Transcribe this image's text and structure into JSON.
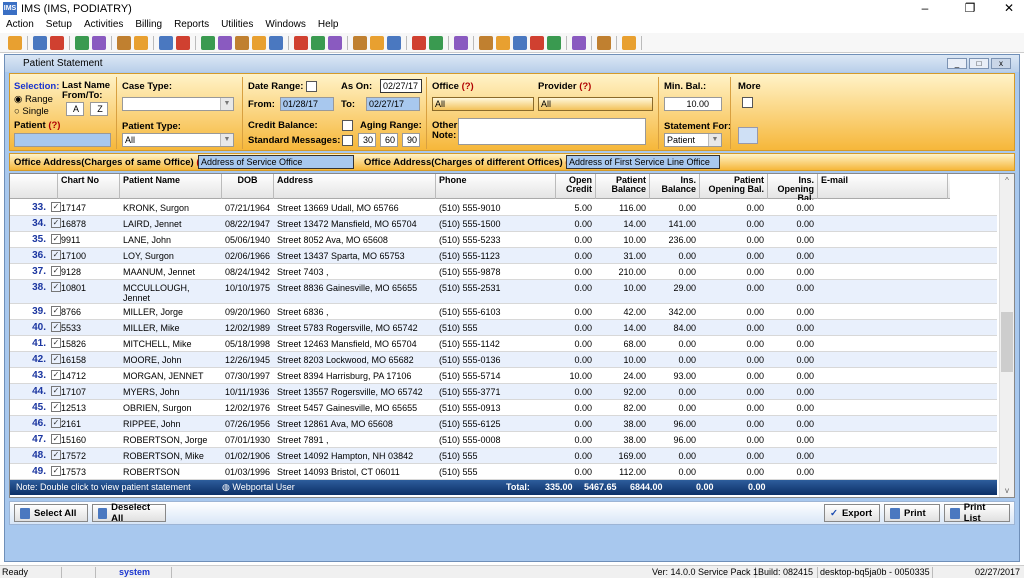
{
  "app": {
    "title": "IMS (IMS, PODIATRY)"
  },
  "menu": [
    "Action",
    "Setup",
    "Activities",
    "Billing",
    "Reports",
    "Utilities",
    "Windows",
    "Help"
  ],
  "window": {
    "title": "Patient Statement"
  },
  "filter": {
    "selection_label": "Selection:",
    "range_label": "Range",
    "single_label": "Single",
    "range_selected": true,
    "last_name_label": "Last Name From/To:",
    "from_letter": "A",
    "to_letter": "Z",
    "patient_label": "Patient",
    "help": "(?)",
    "patient_value": "",
    "case_type_label": "Case Type:",
    "case_type_value": "",
    "patient_type_label": "Patient Type:",
    "patient_type_value": "All",
    "date_range_label": "Date Range:",
    "as_on_label": "As On:",
    "as_on_value": "02/27/17",
    "from_label": "From:",
    "from_value": "01/28/17",
    "to_label": "To:",
    "to_value": "02/27/17",
    "credit_balance_label": "Credit Balance:",
    "standard_messages_label": "Standard Messages:",
    "aging_range_label": "Aging Range:",
    "aging": [
      "30",
      "60",
      "90"
    ],
    "office_label": "Office",
    "office_value": "All",
    "provider_label": "Provider",
    "provider_value": "All",
    "other_note_label": "Other Note:",
    "other_note_value": "",
    "min_bal_label": "Min. Bal.:",
    "min_bal_value": "10.00",
    "statement_for_label": "Statement For:",
    "statement_for_value": "Patient",
    "more_label": "More"
  },
  "address": {
    "same_label": "Office Address(Charges of same Office)",
    "same_value": "Address of Service Office",
    "diff_label": "Office Address(Charges of different Offices)",
    "diff_value": "Address of First Service Line Office"
  },
  "grid": {
    "headers": [
      "Chart No",
      "Patient Name",
      "DOB",
      "Address",
      "Phone",
      "Open Credit",
      "Patient Balance",
      "Ins. Balance",
      "Patient Opening Bal.",
      "Ins. Opening Bal.",
      "E-mail"
    ],
    "rows": [
      [
        "33.",
        "17147",
        "KRONK, Surgon",
        "07/21/1964",
        "Street 13669 Udall, MO 65766",
        "(510) 555-9010",
        "5.00",
        "116.00",
        "0.00",
        "0.00",
        "0.00"
      ],
      [
        "34.",
        "16878",
        "LAIRD, Jennet",
        "08/22/1947",
        "Street 13472 Mansfield, MO 65704",
        "(510) 555-1500",
        "0.00",
        "14.00",
        "141.00",
        "0.00",
        "0.00"
      ],
      [
        "35.",
        "9911",
        "LANE, John",
        "05/06/1940",
        "Street 8052 Ava, MO 65608",
        "(510) 555-5233",
        "0.00",
        "10.00",
        "236.00",
        "0.00",
        "0.00"
      ],
      [
        "36.",
        "17100",
        "LOY, Surgon",
        "02/06/1966",
        "Street 13437 Sparta, MO 65753",
        "(510) 555-1123",
        "0.00",
        "31.00",
        "0.00",
        "0.00",
        "0.00"
      ],
      [
        "37.",
        "9128",
        "MAANUM, Jennet",
        "08/24/1942",
        "Street 7403 ,",
        "(510) 555-9878",
        "0.00",
        "210.00",
        "0.00",
        "0.00",
        "0.00"
      ],
      [
        "38.",
        "10801",
        "MCCULLOUGH, Jennet",
        "10/10/1975",
        "Street 8836 Gainesville, MO 65655",
        "(510) 555-2531",
        "0.00",
        "10.00",
        "29.00",
        "0.00",
        "0.00"
      ],
      [
        "39.",
        "8766",
        "MILLER, Jorge",
        "09/20/1960",
        "Street 6836 ,",
        "(510) 555-6103",
        "0.00",
        "42.00",
        "342.00",
        "0.00",
        "0.00"
      ],
      [
        "40.",
        "5533",
        "MILLER, Mike",
        "12/02/1989",
        "Street 5783 Rogersville, MO 65742",
        "(510) 555",
        "0.00",
        "14.00",
        "84.00",
        "0.00",
        "0.00"
      ],
      [
        "41.",
        "15826",
        "MITCHELL, Mike",
        "05/18/1998",
        "Street 12463 Mansfield, MO 65704",
        "(510) 555-1142",
        "0.00",
        "68.00",
        "0.00",
        "0.00",
        "0.00"
      ],
      [
        "42.",
        "16158",
        "MOORE, John",
        "12/26/1945",
        "Street 8203 Lockwood, MO 65682",
        "(510) 555-0136",
        "0.00",
        "10.00",
        "0.00",
        "0.00",
        "0.00"
      ],
      [
        "43.",
        "14712",
        "MORGAN, JENNET",
        "07/30/1997",
        "Street 8394 Harrisburg, PA 17106",
        "(510) 555-5714",
        "10.00",
        "24.00",
        "93.00",
        "0.00",
        "0.00"
      ],
      [
        "44.",
        "17107",
        "MYERS, John",
        "10/11/1936",
        "Street 13557 Rogersville, MO 65742",
        "(510) 555-3771",
        "0.00",
        "92.00",
        "0.00",
        "0.00",
        "0.00"
      ],
      [
        "45.",
        "12513",
        "OBRIEN, Surgon",
        "12/02/1976",
        "Street 5457 Gainesville, MO 65655",
        "(510) 555-0913",
        "0.00",
        "82.00",
        "0.00",
        "0.00",
        "0.00"
      ],
      [
        "46.",
        "2161",
        "RIPPEE, John",
        "07/26/1956",
        "Street 12861 Ava, MO 65608",
        "(510) 555-6125",
        "0.00",
        "38.00",
        "96.00",
        "0.00",
        "0.00"
      ],
      [
        "47.",
        "15160",
        "ROBERTSON, Jorge",
        "07/01/1930",
        "Street 7891 ,",
        "(510) 555-0008",
        "0.00",
        "38.00",
        "96.00",
        "0.00",
        "0.00"
      ],
      [
        "48.",
        "17572",
        "ROBERTSON, Mike",
        "01/02/1906",
        "Street 14092 Hampton, NH 03842",
        "(510) 555",
        "0.00",
        "169.00",
        "0.00",
        "0.00",
        "0.00"
      ],
      [
        "49.",
        "17573",
        "ROBERTSON",
        "01/03/1996",
        "Street 14093 Bristol, CT 06011",
        "(510) 555",
        "0.00",
        "112.00",
        "0.00",
        "0.00",
        "0.00"
      ]
    ],
    "footer_note": "Note: Double click to view patient statement",
    "webportal": "Webportal User",
    "total_label": "Total:",
    "totals": [
      "335.00",
      "5467.65",
      "6844.00",
      "0.00",
      "0.00"
    ]
  },
  "buttons": {
    "select_all": "Select All",
    "deselect_all": "Deselect All",
    "export": "Export",
    "print": "Print",
    "print_list": "Print List"
  },
  "status": {
    "ready": "Ready",
    "user": "system",
    "version": "Ver: 14.0.0 Service Pack 1",
    "build": "Build: 082415",
    "machine": "desktop-bq5ja0b - 0050335",
    "date": "02/27/2017"
  }
}
